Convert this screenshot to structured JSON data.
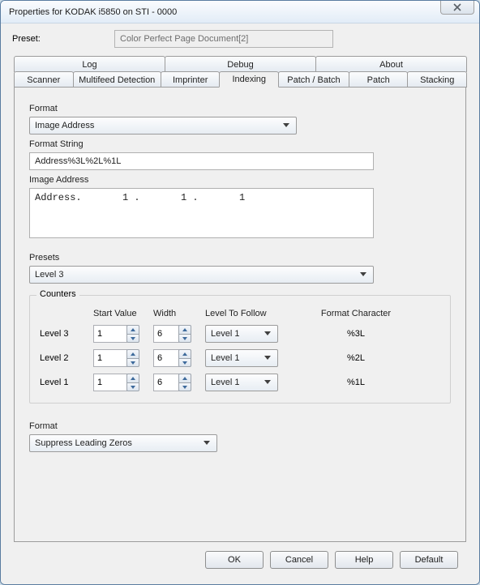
{
  "window": {
    "title": "Properties for KODAK i5850 on STI - 0000"
  },
  "preset": {
    "label": "Preset:",
    "value": "Color Perfect Page Document[2]"
  },
  "tabs": {
    "row1": [
      "Log",
      "Debug",
      "About"
    ],
    "row2": [
      "Scanner",
      "Multifeed Detection",
      "Imprinter",
      "Indexing",
      "Patch / Batch",
      "Patch",
      "Stacking"
    ],
    "active": "Indexing"
  },
  "indexing": {
    "format_label": "Format",
    "format_value": "Image Address",
    "format_string_label": "Format String",
    "format_string_value": "Address%3L%2L%1L",
    "image_address_label": "Image Address",
    "image_address_value": "Address.       1 .       1 .       1",
    "presets_label": "Presets",
    "presets_value": "Level 3",
    "counters": {
      "legend": "Counters",
      "headers": {
        "start": "Start Value",
        "width": "Width",
        "ltf": "Level To Follow",
        "fc": "Format Character"
      },
      "rows": [
        {
          "label": "Level 3",
          "start": "1",
          "width": "6",
          "ltf": "Level 1",
          "fc": "%3L"
        },
        {
          "label": "Level 2",
          "start": "1",
          "width": "6",
          "ltf": "Level 1",
          "fc": "%2L"
        },
        {
          "label": "Level 1",
          "start": "1",
          "width": "6",
          "ltf": "Level 1",
          "fc": "%1L"
        }
      ]
    },
    "format2_label": "Format",
    "format2_value": "Suppress Leading Zeros"
  },
  "buttons": {
    "ok": "OK",
    "cancel": "Cancel",
    "help": "Help",
    "def": "Default"
  }
}
